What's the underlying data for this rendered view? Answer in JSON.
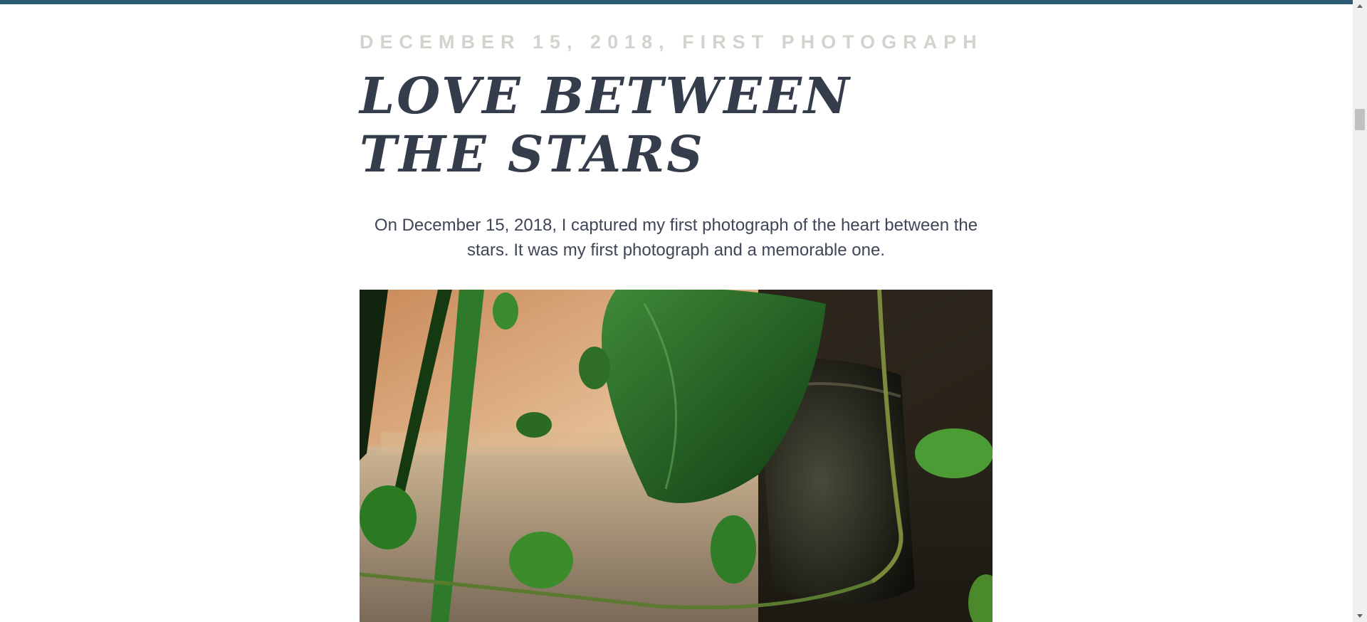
{
  "post": {
    "meta": "December 15, 2018, First Photograph",
    "title": "Love Between The Stars",
    "intro": "On December 15, 2018, I captured my first photograph of the heart between the stars. It was my first photograph and a memorable one."
  },
  "colors": {
    "top_bar": "#2c5a73",
    "title": "#353d4d",
    "meta": "#d3d3cc",
    "body_text": "#3e4657"
  }
}
